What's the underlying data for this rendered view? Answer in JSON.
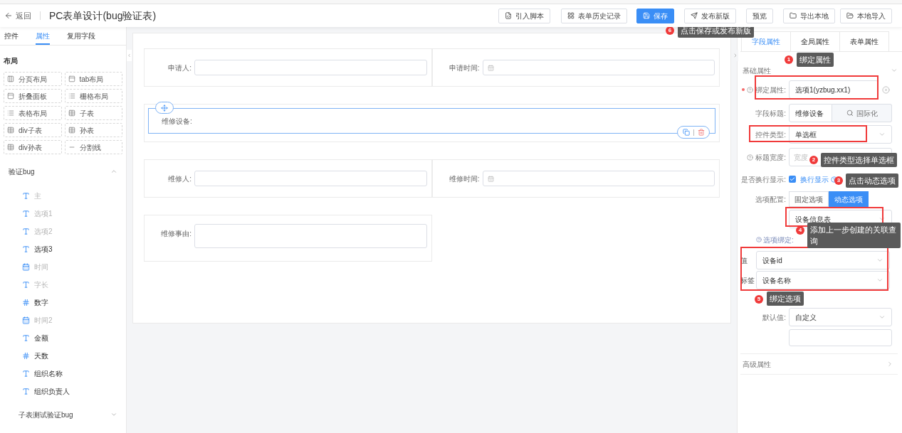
{
  "topbar": {
    "back": "返回",
    "title": "PC表单设计(bug验证表)",
    "buttons": [
      {
        "label": "引入脚本",
        "primary": false
      },
      {
        "label": "表单历史记录",
        "primary": false
      },
      {
        "label": "保存",
        "primary": true
      },
      {
        "label": "发布新版",
        "primary": false
      },
      {
        "label": "预览",
        "primary": false
      },
      {
        "label": "导出本地",
        "primary": false
      },
      {
        "label": "本地导入",
        "primary": false
      }
    ]
  },
  "left_panel": {
    "tabs": [
      {
        "label": "控件",
        "selected": false
      },
      {
        "label": "属性",
        "selected": true
      },
      {
        "label": "复用字段",
        "selected": false
      }
    ],
    "layout_heading": "布局",
    "layout_items": [
      "分页布局",
      "tab布局",
      "折叠面板",
      "栅格布局",
      "表格布局",
      "子表",
      "div子表",
      "孙表",
      "div孙表",
      "分割线"
    ],
    "groups": [
      {
        "title": "验证bug",
        "expanded": true,
        "fields": [
          {
            "label": "主",
            "kind": "text",
            "disabled": true
          },
          {
            "label": "选项1",
            "kind": "text",
            "disabled": true
          },
          {
            "label": "选项2",
            "kind": "text",
            "disabled": true
          },
          {
            "label": "选项3",
            "kind": "text",
            "disabled": false
          },
          {
            "label": "时间",
            "kind": "date",
            "disabled": true
          },
          {
            "label": "字长",
            "kind": "text",
            "disabled": true
          },
          {
            "label": "数字",
            "kind": "number",
            "disabled": false
          },
          {
            "label": "时间2",
            "kind": "date",
            "disabled": true
          },
          {
            "label": "金额",
            "kind": "text",
            "disabled": false
          },
          {
            "label": "天数",
            "kind": "number",
            "disabled": false
          },
          {
            "label": "组织名称",
            "kind": "text",
            "disabled": false
          },
          {
            "label": "组织负责人",
            "kind": "text",
            "disabled": false
          }
        ]
      },
      {
        "title": "子表测试验证bug",
        "expanded": false
      }
    ]
  },
  "canvas": {
    "rows": [
      {
        "selected": false,
        "fields": [
          {
            "label": "申请人:",
            "kind": "input"
          },
          {
            "label": "申请时间:",
            "kind": "date"
          }
        ]
      },
      {
        "selected": true,
        "fields": [
          {
            "label": "维修设备:",
            "kind": "radio"
          }
        ]
      },
      {
        "selected": false,
        "fields": [
          {
            "label": "维修人:",
            "kind": "input"
          },
          {
            "label": "维修时间:",
            "kind": "date"
          }
        ]
      },
      {
        "selected": false,
        "fields": [
          {
            "label": "维修事由:",
            "kind": "textarea"
          }
        ]
      }
    ]
  },
  "right_panel": {
    "tabs": [
      {
        "label": "字段属性",
        "selected": true
      },
      {
        "label": "全局属性",
        "selected": false
      },
      {
        "label": "表单属性",
        "selected": false
      }
    ],
    "section": {
      "title": "基础属性",
      "expanded": true
    },
    "bind": {
      "label": "绑定属性:",
      "required": true,
      "value": "选项1(yzbug.xx1)"
    },
    "field_title": {
      "label": "字段标题:",
      "value": "维修设备",
      "button": "国际化"
    },
    "control_type": {
      "label": "控件类型:",
      "value": "单选框"
    },
    "title_width": {
      "label": "标题宽度:",
      "placeholder": "宽度"
    },
    "wrap": {
      "label": "是否换行显示:",
      "checked": true,
      "text": "换行显示"
    },
    "options_config": {
      "label": "选项配置:",
      "segments": [
        {
          "label": "固定选项",
          "selected": false
        },
        {
          "label": "动态选项",
          "selected": true
        }
      ],
      "source": "设备信息表"
    },
    "option_binding": {
      "label": "选项绑定:",
      "rows": [
        {
          "label": "值",
          "value": "设备id"
        },
        {
          "label": "标签",
          "value": "设备名称"
        }
      ]
    },
    "default_value": {
      "label": "默认值:",
      "value": "自定义"
    },
    "advanced": {
      "title": "高级属性",
      "expanded": false
    }
  },
  "annotations": [
    {
      "number": "6",
      "text": "点击保存或发布新版"
    },
    {
      "number": "1",
      "text": "绑定属性"
    },
    {
      "number": "2",
      "text": "控件类型选择单选框"
    },
    {
      "number": "3",
      "text": "点击动态选项"
    },
    {
      "number": "4",
      "text": "添加上一步创建的关联查询"
    },
    {
      "number": "5",
      "text": "绑定选项"
    }
  ]
}
